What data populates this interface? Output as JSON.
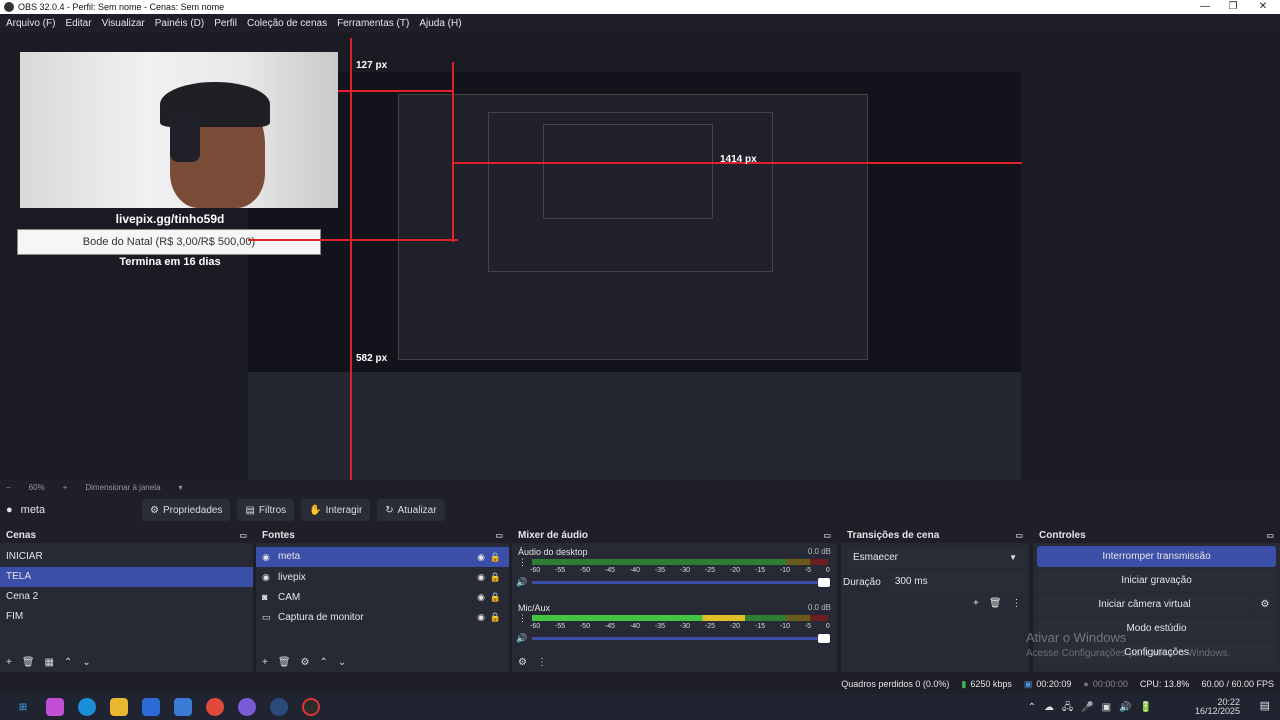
{
  "window": {
    "title": "OBS 32.0.4 - Perfil: Sem nome - Cenas: Sem nome",
    "controls": [
      "—",
      "❐",
      "✕"
    ]
  },
  "menu": [
    "Arquivo (F)",
    "Editar",
    "Visualizar",
    "Painéis (D)",
    "Perfil",
    "Coleção de cenas",
    "Ferramentas (T)",
    "Ajuda (H)"
  ],
  "preview": {
    "livepix_url": "livepix.gg/tinho59d",
    "goal_text": "Bode do Natal (R$ 3,00/R$ 500,00)",
    "ends_text": "Termina em 16 dias",
    "measure_1": "127 px",
    "measure_2": "1414 px",
    "measure_3": "582 px"
  },
  "zoom": {
    "minus": "−",
    "level": "60%",
    "plus": "+",
    "mode": "Dimensionar à janela"
  },
  "toolbar": {
    "source_name": "meta",
    "properties": "Propriedades",
    "filters": "Filtros",
    "interact": "Interagir",
    "refresh": "Atualizar"
  },
  "scenes": {
    "title": "Cenas",
    "items": [
      "INICIAR",
      "TELA",
      "Cena 2",
      "FIM"
    ],
    "selected": "TELA"
  },
  "sources": {
    "title": "Fontes",
    "items": [
      {
        "name": "meta",
        "icon": "browser-icon"
      },
      {
        "name": "livepix",
        "icon": "browser-icon"
      },
      {
        "name": "CAM",
        "icon": "camera-icon"
      },
      {
        "name": "Captura de monitor",
        "icon": "monitor-icon"
      }
    ]
  },
  "mixer": {
    "title": "Mixer de áudio",
    "channels": [
      {
        "name": "Áudio do desktop",
        "db": "0.0 dB",
        "level": 0.0
      },
      {
        "name": "Mic/Aux",
        "db": "0.0 dB",
        "level": 0.72
      }
    ],
    "ticks": [
      "-60",
      "-55",
      "-50",
      "-45",
      "-40",
      "-35",
      "-30",
      "-25",
      "-20",
      "-15",
      "-10",
      "-5",
      "0"
    ]
  },
  "transitions": {
    "title": "Transições de cena",
    "selected": "Esmaecer",
    "duration_label": "Duração",
    "duration_value": "300 ms"
  },
  "controls": {
    "title": "Controles",
    "stop_stream": "Interromper transmissão",
    "start_recording": "Iniciar gravação",
    "start_virtual_cam": "Iniciar câmera virtual",
    "studio_mode": "Modo estúdio",
    "settings": "Configurações"
  },
  "watermark": {
    "line1": "Ativar o Windows",
    "line2": "Acesse Configurações para ativar o Windows."
  },
  "status": {
    "dropped_frames": "Quadros perdidos 0 (0.0%)",
    "bitrate": "6250 kbps",
    "stream_time": "00:20:09",
    "rec_time": "00:00:00",
    "cpu": "CPU: 13.8%",
    "fps": "60.00 / 60.00 FPS"
  },
  "taskbar": {
    "time": "20:22",
    "date": "16/12/2025"
  },
  "colors": {
    "accent": "#3b4ea8",
    "live_red": "#e0202a"
  }
}
